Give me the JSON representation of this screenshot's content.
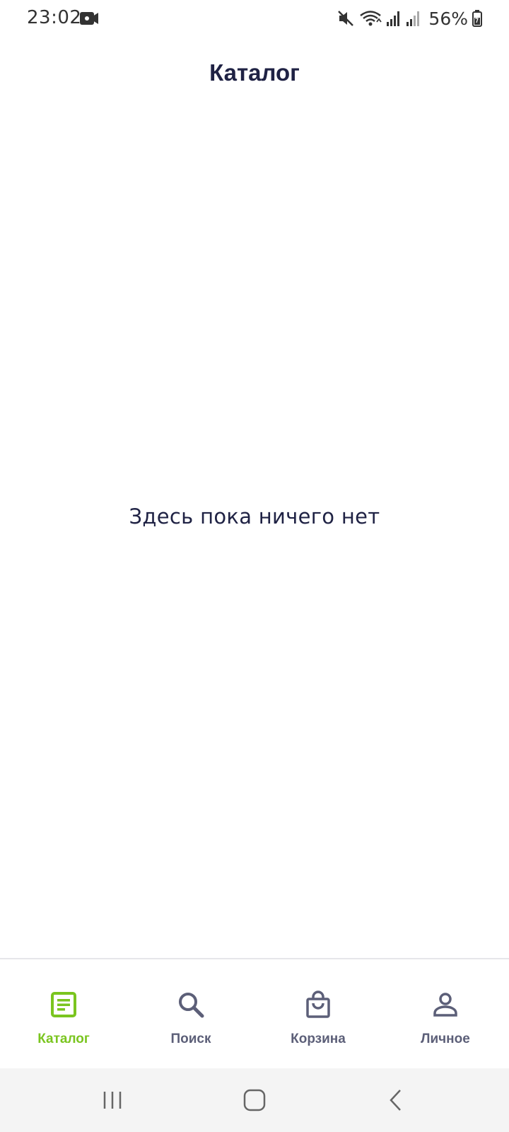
{
  "status_bar": {
    "time": "23:02",
    "battery": "56%",
    "icons": [
      "video-recording-icon",
      "mute-icon",
      "wifi-icon",
      "signal-icon",
      "signal-icon-2",
      "battery-icon"
    ]
  },
  "header": {
    "title": "Каталог"
  },
  "main": {
    "empty_message": "Здесь пока ничего нет"
  },
  "tabbar": {
    "active_color": "#7ac51f",
    "inactive_color": "#5c5f78",
    "tabs": [
      {
        "label": "Каталог",
        "icon": "catalog-icon",
        "active": true
      },
      {
        "label": "Поиск",
        "icon": "search-icon",
        "active": false
      },
      {
        "label": "Корзина",
        "icon": "shopping-bag-icon",
        "active": false
      },
      {
        "label": "Личное",
        "icon": "person-icon",
        "active": false
      }
    ]
  },
  "system_nav": {
    "buttons": [
      "recent-apps-icon",
      "home-icon",
      "back-icon"
    ]
  }
}
